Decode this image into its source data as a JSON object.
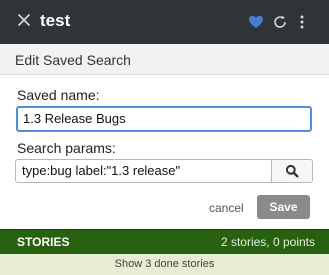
{
  "window": {
    "title": "test"
  },
  "panel": {
    "title": "Edit Saved Search"
  },
  "form": {
    "saved_name_label": "Saved name:",
    "saved_name_value": "1.3 Release Bugs",
    "search_params_label": "Search params:",
    "search_params_value": "type:bug label:\"1.3 release\"",
    "cancel_label": "cancel",
    "save_label": "Save"
  },
  "stories": {
    "label": "STORIES",
    "summary": "2 stories, 0 points",
    "show_done": "Show 3 done stories"
  },
  "colors": {
    "titlebar": "#2e3437",
    "heart_icon": "#4a7bd0",
    "stories_bar": "#27610f",
    "done_bar": "#e6edd3",
    "input_focus": "#4a90d9"
  },
  "icons": [
    "close-icon",
    "heart-icon",
    "refresh-icon",
    "more-icon",
    "search-icon"
  ]
}
